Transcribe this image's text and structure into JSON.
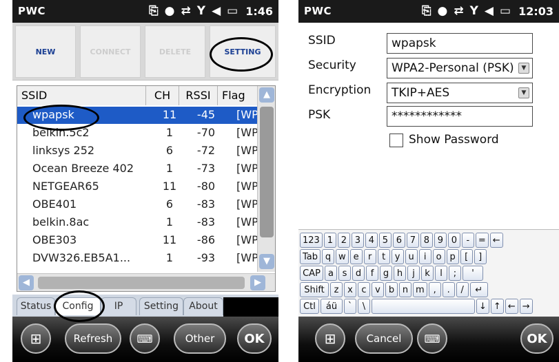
{
  "left": {
    "status": {
      "app": "PWC",
      "time": "1:46"
    },
    "toolbar": {
      "new": "NEW",
      "connect": "CONNECT",
      "delete": "DELETE",
      "setting": "SETTING"
    },
    "table": {
      "headers": [
        "SSID",
        "CH",
        "RSSI",
        "Flag"
      ],
      "rows": [
        {
          "ssid": "wpapsk",
          "ch": "11",
          "rssi": "-45",
          "flag": "[WP"
        },
        {
          "ssid": "belkin.5c2",
          "ch": "1",
          "rssi": "-70",
          "flag": "[WP."
        },
        {
          "ssid": "linksys 252",
          "ch": "6",
          "rssi": "-72",
          "flag": "[WP."
        },
        {
          "ssid": "Ocean Breeze 402",
          "ch": "1",
          "rssi": "-73",
          "flag": "[WP."
        },
        {
          "ssid": "NETGEAR65",
          "ch": "11",
          "rssi": "-80",
          "flag": "[WP."
        },
        {
          "ssid": "OBE401",
          "ch": "6",
          "rssi": "-83",
          "flag": "[WP."
        },
        {
          "ssid": "belkin.8ac",
          "ch": "1",
          "rssi": "-83",
          "flag": "[WP."
        },
        {
          "ssid": "OBE303",
          "ch": "11",
          "rssi": "-86",
          "flag": "[WP."
        },
        {
          "ssid": "DVW326.EB5A1...",
          "ch": "1",
          "rssi": "-93",
          "flag": "[WP"
        }
      ]
    },
    "tabs": {
      "status": "Status",
      "config": "Config",
      "ip": "IP",
      "setting": "Setting",
      "about": "About"
    },
    "softkeys": {
      "refresh": "Refresh",
      "other": "Other",
      "ok": "OK"
    }
  },
  "right": {
    "status": {
      "app": "PWC",
      "time": "12:03"
    },
    "form": {
      "ssid_label": "SSID",
      "ssid_value": "wpapsk",
      "security_label": "Security",
      "security_value": "WPA2-Personal (PSK)",
      "encryption_label": "Encryption",
      "encryption_value": "TKIP+AES",
      "psk_label": "PSK",
      "psk_value": "************",
      "show_password_label": "Show Password"
    },
    "keyboard": {
      "row1": [
        "123",
        "1",
        "2",
        "3",
        "4",
        "5",
        "6",
        "7",
        "8",
        "9",
        "0",
        "-",
        "=",
        "←"
      ],
      "row2": [
        "Tab",
        "q",
        "w",
        "e",
        "r",
        "t",
        "y",
        "u",
        "i",
        "o",
        "p",
        "[",
        "]"
      ],
      "row3": [
        "CAP",
        "a",
        "s",
        "d",
        "f",
        "g",
        "h",
        "j",
        "k",
        "l",
        ";",
        "'"
      ],
      "row4": [
        "Shift",
        "z",
        "x",
        "c",
        "v",
        "b",
        "n",
        "m",
        ",",
        ".",
        "/",
        "↵"
      ],
      "row5": [
        "Ctl",
        "áü",
        "`",
        "\\",
        "",
        "↓",
        "↑",
        "←",
        "→"
      ]
    },
    "softkeys": {
      "cancel": "Cancel",
      "ok": "OK"
    }
  },
  "icons": [
    "windows-icon",
    "keyboard-icon",
    "signal-icon",
    "volume-icon",
    "battery-icon",
    "sync-icon",
    "device-icon"
  ]
}
